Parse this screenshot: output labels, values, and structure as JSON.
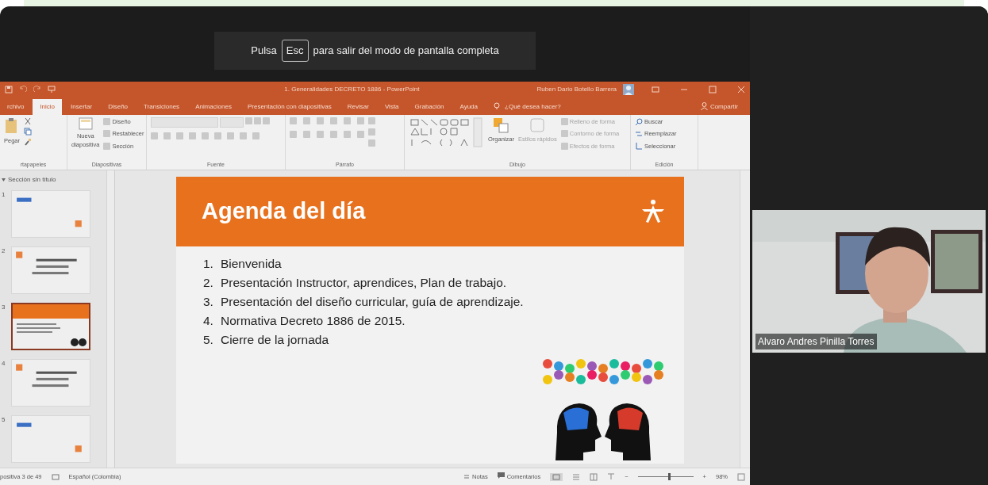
{
  "toast": {
    "prefix": "Pulsa",
    "key": "Esc",
    "suffix": "para salir del modo de pantalla completa"
  },
  "powerpoint": {
    "title": "1. Generalidades DECRETO 1886 - PowerPoint",
    "user": "Ruben Dario Botello Barrera",
    "tabs": [
      {
        "label": "rchivo",
        "selected": false
      },
      {
        "label": "Inicio",
        "selected": true
      },
      {
        "label": "Insertar",
        "selected": false
      },
      {
        "label": "Diseño",
        "selected": false
      },
      {
        "label": "Transiciones",
        "selected": false
      },
      {
        "label": "Animaciones",
        "selected": false
      },
      {
        "label": "Presentación con diapositivas",
        "selected": false
      },
      {
        "label": "Revisar",
        "selected": false
      },
      {
        "label": "Vista",
        "selected": false
      },
      {
        "label": "Grabación",
        "selected": false
      },
      {
        "label": "Ayuda",
        "selected": false
      }
    ],
    "tell_me": "¿Qué desea hacer?",
    "share": "Compartir",
    "ribbon_groups": [
      {
        "label": "rtapapeles",
        "kind": "clipboard",
        "buttons": [
          {
            "label": "Pegar",
            "disabled": false
          }
        ]
      },
      {
        "label": "Diapositivas",
        "kind": "slides",
        "buttons": [
          {
            "label": "Nueva diapositiva",
            "disabled": false
          },
          {
            "label": "Diseño",
            "disabled": false
          },
          {
            "label": "Restablecer",
            "disabled": false
          },
          {
            "label": "Sección",
            "disabled": false
          }
        ]
      },
      {
        "label": "Fuente",
        "kind": "font"
      },
      {
        "label": "Párrafo",
        "kind": "paragraph"
      },
      {
        "label": "Dibujo",
        "kind": "drawing",
        "buttons": [
          {
            "label": "Organizar",
            "disabled": false
          },
          {
            "label": "Estilos rápidos",
            "disabled": true
          },
          {
            "label": "Relleno de forma",
            "disabled": true
          },
          {
            "label": "Contorno de forma",
            "disabled": true
          },
          {
            "label": "Efectos de forma",
            "disabled": true
          }
        ]
      },
      {
        "label": "Edición",
        "kind": "editing",
        "buttons": [
          {
            "label": "Buscar",
            "disabled": false
          },
          {
            "label": "Reemplazar",
            "disabled": false
          },
          {
            "label": "Seleccionar",
            "disabled": false
          }
        ]
      }
    ],
    "section": "Sección sin título",
    "thumbnails": [
      {
        "number": "1",
        "selected": false
      },
      {
        "number": "2",
        "selected": false
      },
      {
        "number": "3",
        "selected": true
      },
      {
        "number": "4",
        "selected": false
      },
      {
        "number": "5",
        "selected": false
      }
    ],
    "slide": {
      "title": "Agenda del día",
      "items": [
        {
          "number": "1.",
          "text": "Bienvenida"
        },
        {
          "number": "2.",
          "text": "Presentación Instructor, aprendices, Plan de trabajo."
        },
        {
          "number": "3.",
          "text": "Presentación del diseño curricular, guía de aprendizaje."
        },
        {
          "number": "4.",
          "text": "Normativa Decreto 1886 de 2015."
        },
        {
          "number": "5.",
          "text": "Cierre de la jornada"
        }
      ]
    },
    "status_bar": {
      "slide": "positiva 3 de 49",
      "language": "Español (Colombia)",
      "notes": "Notas",
      "comments": "Comentarios",
      "zoom": "98%",
      "zoom_out": "−",
      "zoom_in": "+",
      "level": 0.55
    }
  },
  "participant": {
    "name": "Alvaro Andres Pinilla Torres"
  }
}
